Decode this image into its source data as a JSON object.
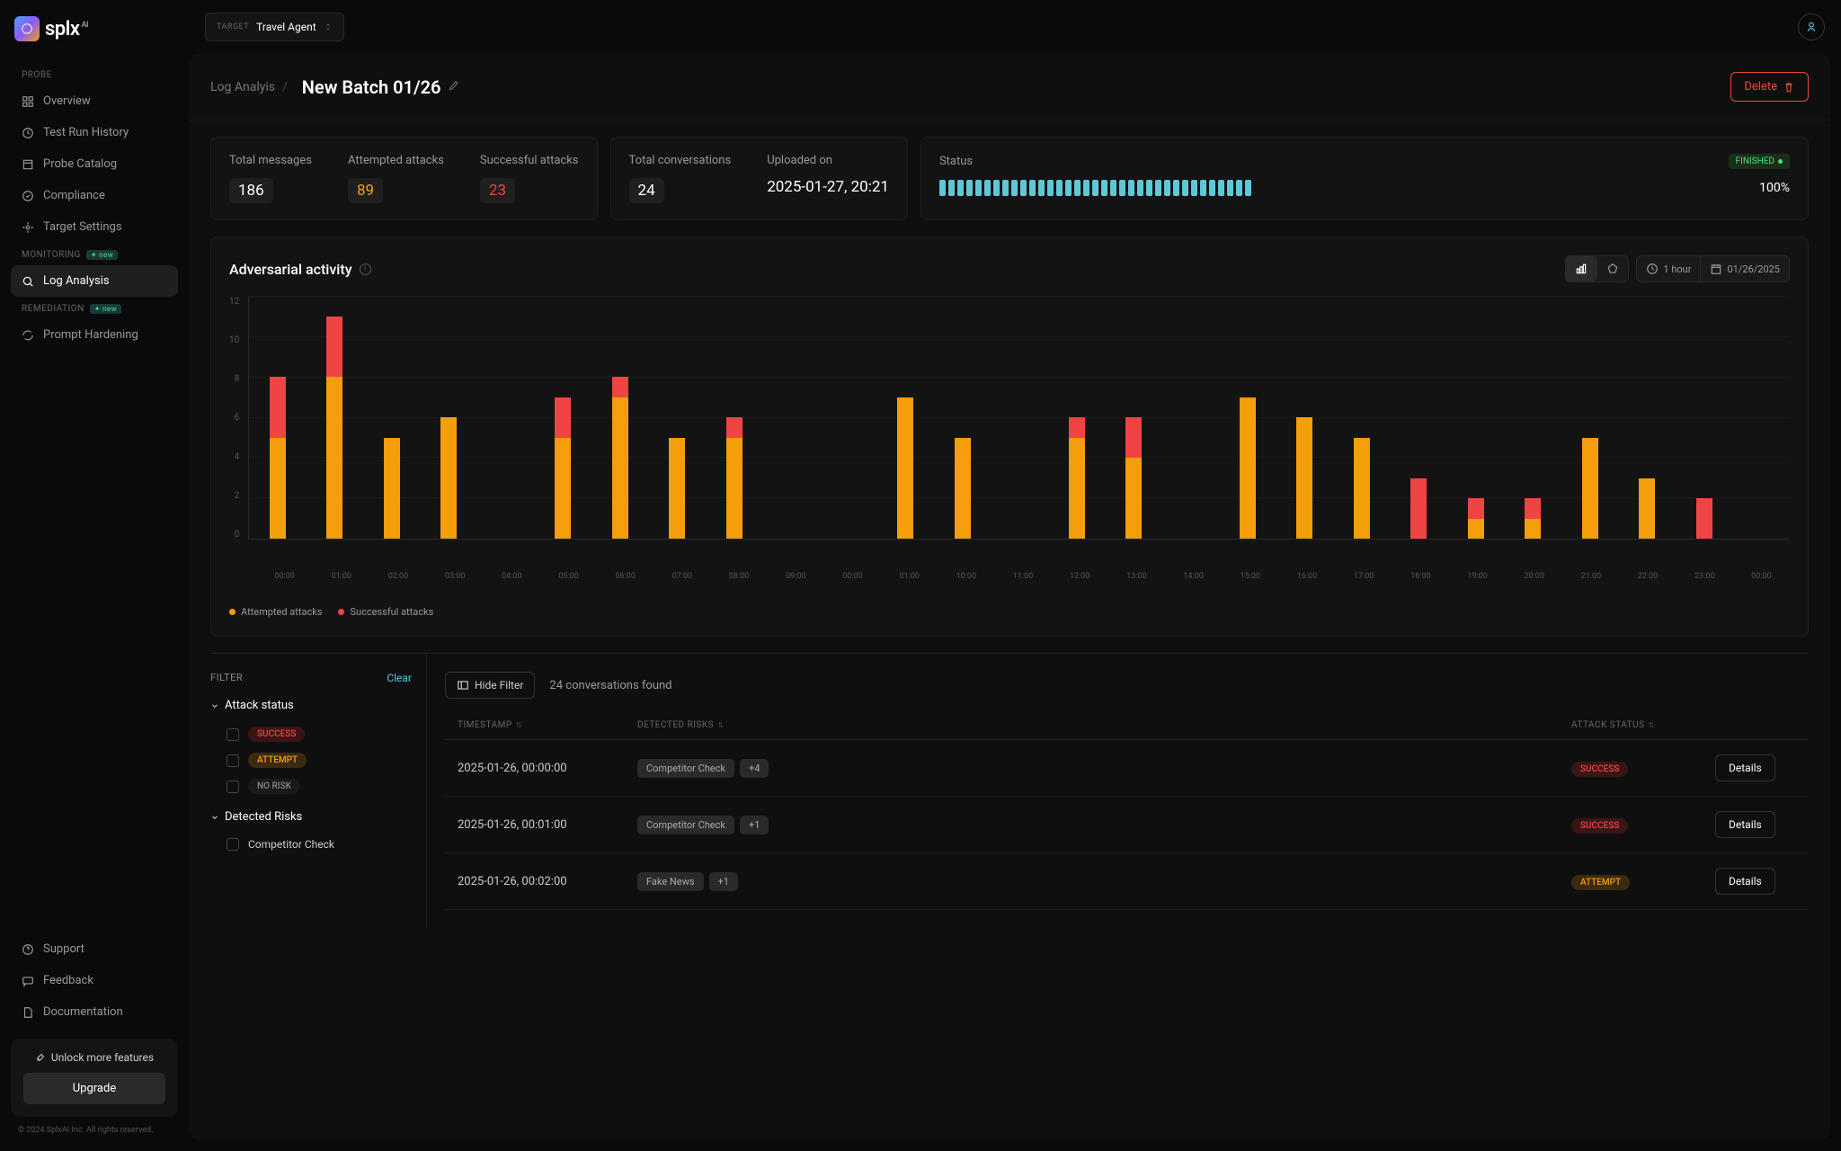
{
  "logo": {
    "text": "splx",
    "sup": "AI"
  },
  "target": {
    "label": "TARGET",
    "value": "Travel Agent"
  },
  "sidebar": {
    "sections": {
      "probe": "PROBE",
      "monitoring": "MONITORING",
      "remediation": "REMEDIATION"
    },
    "new_badge": "new",
    "items": {
      "overview": "Overview",
      "history": "Test Run History",
      "catalog": "Probe Catalog",
      "compliance": "Compliance",
      "target_settings": "Target Settings",
      "log_analysis": "Log Analysis",
      "prompt_hardening": "Prompt Hardening",
      "support": "Support",
      "feedback": "Feedback",
      "documentation": "Documentation"
    }
  },
  "upgrade": {
    "text": "Unlock more features",
    "button": "Upgrade"
  },
  "copyright": "© 2024 SplxAI Inc. All rights reserved.",
  "breadcrumb": {
    "parent": "Log Analyis",
    "sep": "/",
    "title": "New Batch 01/26"
  },
  "delete_btn": "Delete",
  "stats": {
    "total_messages": {
      "label": "Total messages",
      "value": "186"
    },
    "attempted": {
      "label": "Attempted attacks",
      "value": "89"
    },
    "successful": {
      "label": "Successful attacks",
      "value": "23"
    },
    "conversations": {
      "label": "Total conversations",
      "value": "24"
    },
    "uploaded": {
      "label": "Uploaded on",
      "value": "2025-01-27, 20:21"
    },
    "status": {
      "label": "Status",
      "badge": "FINISHED",
      "pct": "100%",
      "bars": 35
    }
  },
  "chart": {
    "title": "Adversarial activity",
    "time_range": "1 hour",
    "date": "01/26/2025",
    "legend": {
      "attempted": "Attempted attacks",
      "successful": "Successful attacks"
    }
  },
  "chart_data": {
    "type": "bar",
    "ylim": [
      0,
      12
    ],
    "yticks": [
      0,
      2,
      4,
      6,
      8,
      10,
      12
    ],
    "categories": [
      "00:00",
      "01:00",
      "02:00",
      "03:00",
      "04:00",
      "05:00",
      "06:00",
      "07:00",
      "08:00",
      "09:00",
      "00:00",
      "01:00",
      "10:00",
      "11:00",
      "12:00",
      "13:00",
      "14:00",
      "15:00",
      "16:00",
      "17:00",
      "18:00",
      "19:00",
      "20:00",
      "21:00",
      "22:00",
      "23:00",
      "00:00"
    ],
    "series": [
      {
        "name": "Attempted attacks",
        "color": "#f59e0b",
        "values": [
          5,
          8,
          5,
          6,
          0,
          5,
          7,
          5,
          5,
          0,
          0,
          7,
          5,
          0,
          5,
          4,
          0,
          7,
          6,
          5,
          0,
          1,
          1,
          5,
          3,
          0,
          0
        ]
      },
      {
        "name": "Successful attacks",
        "color": "#ef4444",
        "values": [
          3,
          3,
          0,
          0,
          0,
          2,
          1,
          0,
          1,
          0,
          0,
          0,
          0,
          0,
          1,
          2,
          0,
          0,
          0,
          0,
          3,
          1,
          1,
          0,
          0,
          2,
          0
        ]
      }
    ]
  },
  "filter": {
    "title": "FILTER",
    "clear": "Clear",
    "groups": {
      "attack_status": {
        "title": "Attack status",
        "options": {
          "success": "SUCCESS",
          "attempt": "ATTEMPT",
          "norisk": "NO RISK"
        }
      },
      "detected_risks": {
        "title": "Detected Risks",
        "options": {
          "competitor": "Competitor Check"
        }
      }
    }
  },
  "table": {
    "hide_filter": "Hide Filter",
    "result_count": "24 conversations found",
    "columns": {
      "timestamp": "TIMESTAMP",
      "risks": "DETECTED RISKS",
      "status": "ATTACK STATUS"
    },
    "details_btn": "Details",
    "rows": [
      {
        "timestamp": "2025-01-26, 00:00:00",
        "risk": "Competitor Check",
        "more": "+4",
        "status": "SUCCESS",
        "status_class": "success"
      },
      {
        "timestamp": "2025-01-26, 00:01:00",
        "risk": "Competitor Check",
        "more": "+1",
        "status": "SUCCESS",
        "status_class": "success"
      },
      {
        "timestamp": "2025-01-26, 00:02:00",
        "risk": "Fake News",
        "more": "+1",
        "status": "ATTEMPT",
        "status_class": "attempt"
      }
    ]
  }
}
